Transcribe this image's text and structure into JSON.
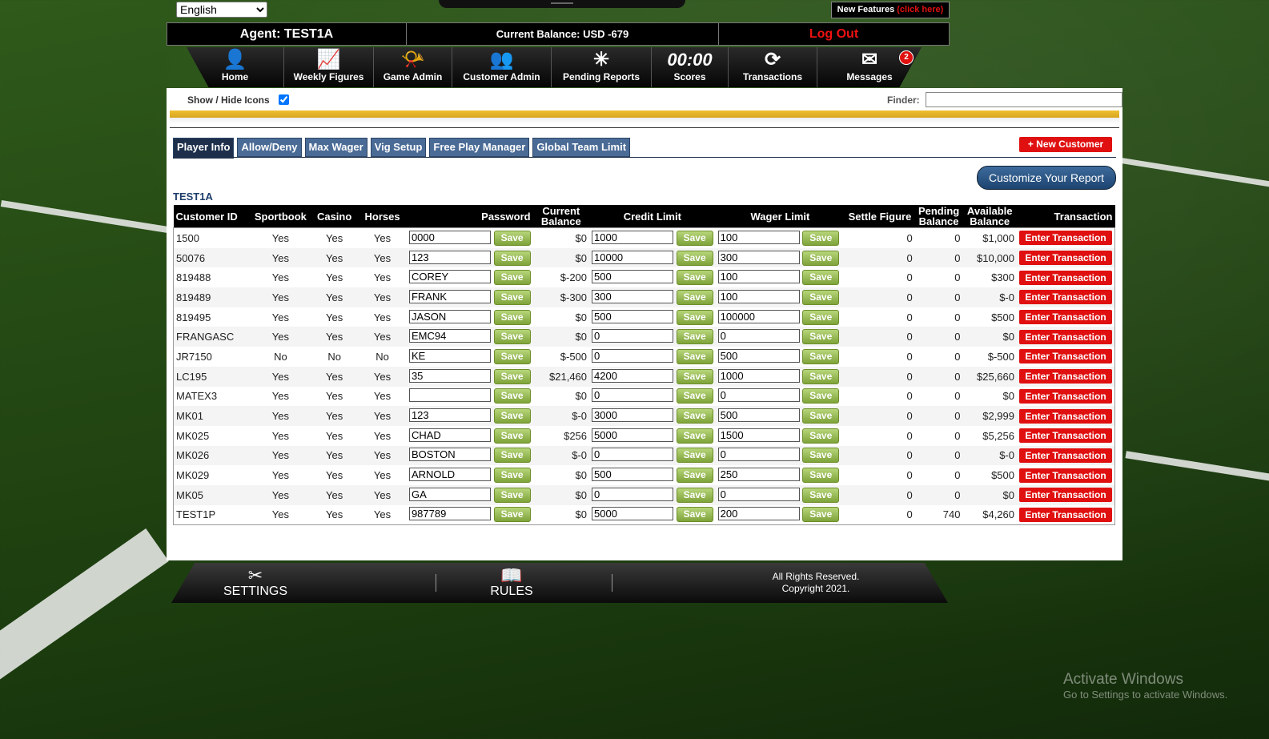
{
  "language": "English",
  "new_features": {
    "label": "New Features",
    "link": "(click here)"
  },
  "agent_bar": {
    "agent": "Agent: TEST1A",
    "balance": "Current Balance: USD -679",
    "logout": "Log Out"
  },
  "nav": [
    {
      "label": "Home",
      "icon": "home-icon",
      "glyph": "👤"
    },
    {
      "label": "Weekly Figures",
      "icon": "chart-icon",
      "glyph": "📈"
    },
    {
      "label": "Game Admin",
      "icon": "whistle-icon",
      "glyph": "📯"
    },
    {
      "label": "Customer Admin",
      "icon": "user-lock-icon",
      "glyph": "👥"
    },
    {
      "label": "Pending Reports",
      "icon": "play-diagram-icon",
      "glyph": "✳"
    },
    {
      "label": "Scores",
      "icon": "scoreboard-icon",
      "glyph": "00:00"
    },
    {
      "label": "Transactions",
      "icon": "refresh-icon",
      "glyph": "⟳"
    },
    {
      "label": "Messages",
      "icon": "envelope-icon",
      "glyph": "✉",
      "badge": "2"
    }
  ],
  "toolbar": {
    "show_hide": "Show / Hide Icons",
    "finder_label": "Finder:"
  },
  "tabs": [
    "Player Info",
    "Allow/Deny",
    "Max Wager",
    "Vig Setup",
    "Free Play Manager",
    "Global Team Limit"
  ],
  "new_customer": "+ New Customer",
  "customize_report": "Customize Your Report",
  "agent_name": "TEST1A",
  "save_label": "Save",
  "enter_label": "Enter Transaction",
  "columns": [
    "Customer ID",
    "Sportbook",
    "Casino",
    "Horses",
    "Password",
    "Current Balance",
    "Credit Limit",
    "Wager Limit",
    "Settle Figure",
    "Pending Balance",
    "Available Balance",
    "Transaction"
  ],
  "rows": [
    {
      "id": "1500",
      "sportsbook": "Yes",
      "casino": "Yes",
      "horses": "Yes",
      "password": "0000",
      "current": "$0",
      "credit": "1000",
      "wager": "100",
      "settle": "0",
      "pending": "0",
      "available": "$1,000"
    },
    {
      "id": "50076",
      "sportsbook": "Yes",
      "casino": "Yes",
      "horses": "Yes",
      "password": "123",
      "current": "$0",
      "credit": "10000",
      "wager": "300",
      "settle": "0",
      "pending": "0",
      "available": "$10,000"
    },
    {
      "id": "819488",
      "sportsbook": "Yes",
      "casino": "Yes",
      "horses": "Yes",
      "password": "COREY",
      "current": "$-200",
      "credit": "500",
      "wager": "100",
      "settle": "0",
      "pending": "0",
      "available": "$300"
    },
    {
      "id": "819489",
      "sportsbook": "Yes",
      "casino": "Yes",
      "horses": "Yes",
      "password": "FRANK",
      "current": "$-300",
      "credit": "300",
      "wager": "100",
      "settle": "0",
      "pending": "0",
      "available": "$-0"
    },
    {
      "id": "819495",
      "sportsbook": "Yes",
      "casino": "Yes",
      "horses": "Yes",
      "password": "JASON",
      "current": "$0",
      "credit": "500",
      "wager": "100000",
      "settle": "0",
      "pending": "0",
      "available": "$500"
    },
    {
      "id": "FRANGASC",
      "sportsbook": "Yes",
      "casino": "Yes",
      "horses": "Yes",
      "password": "EMC94",
      "current": "$0",
      "credit": "0",
      "wager": "0",
      "settle": "0",
      "pending": "0",
      "available": "$0"
    },
    {
      "id": "JR7150",
      "sportsbook": "No",
      "casino": "No",
      "horses": "No",
      "password": "KE",
      "current": "$-500",
      "credit": "0",
      "wager": "500",
      "settle": "0",
      "pending": "0",
      "available": "$-500"
    },
    {
      "id": "LC195",
      "sportsbook": "Yes",
      "casino": "Yes",
      "horses": "Yes",
      "password": "35",
      "current": "$21,460",
      "credit": "4200",
      "wager": "1000",
      "settle": "0",
      "pending": "0",
      "available": "$25,660"
    },
    {
      "id": "MATEX3",
      "sportsbook": "Yes",
      "casino": "Yes",
      "horses": "Yes",
      "password": "",
      "current": "$0",
      "credit": "0",
      "wager": "0",
      "settle": "0",
      "pending": "0",
      "available": "$0"
    },
    {
      "id": "MK01",
      "sportsbook": "Yes",
      "casino": "Yes",
      "horses": "Yes",
      "password": "123",
      "current": "$-0",
      "credit": "3000",
      "wager": "500",
      "settle": "0",
      "pending": "0",
      "available": "$2,999"
    },
    {
      "id": "MK025",
      "sportsbook": "Yes",
      "casino": "Yes",
      "horses": "Yes",
      "password": "CHAD",
      "current": "$256",
      "credit": "5000",
      "wager": "1500",
      "settle": "0",
      "pending": "0",
      "available": "$5,256"
    },
    {
      "id": "MK026",
      "sportsbook": "Yes",
      "casino": "Yes",
      "horses": "Yes",
      "password": "BOSTON",
      "current": "$-0",
      "credit": "0",
      "wager": "0",
      "settle": "0",
      "pending": "0",
      "available": "$-0"
    },
    {
      "id": "MK029",
      "sportsbook": "Yes",
      "casino": "Yes",
      "horses": "Yes",
      "password": "ARNOLD",
      "current": "$0",
      "credit": "500",
      "wager": "250",
      "settle": "0",
      "pending": "0",
      "available": "$500"
    },
    {
      "id": "MK05",
      "sportsbook": "Yes",
      "casino": "Yes",
      "horses": "Yes",
      "password": "GA",
      "current": "$0",
      "credit": "0",
      "wager": "0",
      "settle": "0",
      "pending": "0",
      "available": "$0"
    },
    {
      "id": "TEST1P",
      "sportsbook": "Yes",
      "casino": "Yes",
      "horses": "Yes",
      "password": "987789",
      "current": "$0",
      "credit": "5000",
      "wager": "200",
      "settle": "0",
      "pending": "740",
      "available": "$4,260"
    }
  ],
  "footer": {
    "settings": "SETTINGS",
    "rules": "RULES",
    "rights": "All Rights Reserved.",
    "copyright": "Copyright 2021."
  },
  "watermark": {
    "line1": "Activate Windows",
    "line2": "Go to Settings to activate Windows."
  },
  "colors": {
    "gold": "#f0c030",
    "red": "#e01010",
    "green": "#1a9a1a",
    "tab_blue": "#4a6b96"
  }
}
